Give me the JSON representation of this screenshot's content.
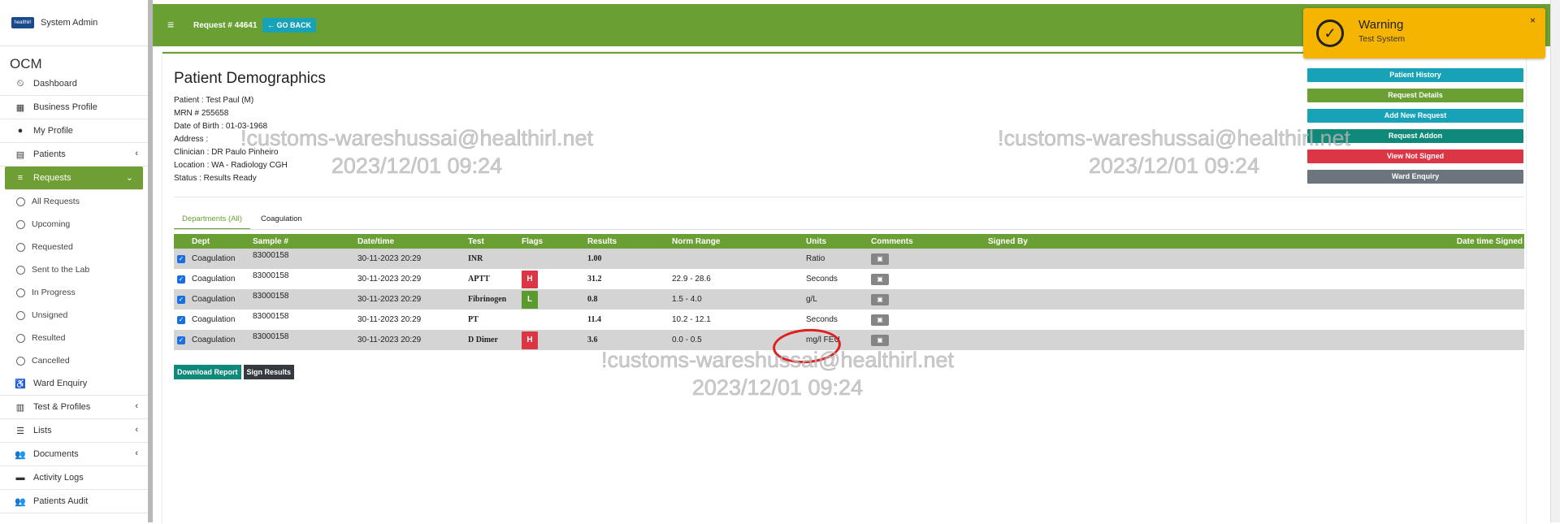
{
  "sidebar": {
    "user": "System Admin",
    "logo_text": "healthirl",
    "app_name": "OCM",
    "items": [
      {
        "label": "Dashboard",
        "icon": "⏲"
      },
      {
        "label": "Business Profile",
        "icon": "▦"
      },
      {
        "label": "My Profile",
        "icon": "●"
      },
      {
        "label": "Patients",
        "icon": "▤",
        "chevron": "‹"
      },
      {
        "label": "Requests",
        "icon": "≡",
        "chevron": "⌄"
      }
    ],
    "sub_items": [
      "All Requests",
      "Upcoming",
      "Requested",
      "Sent to the Lab",
      "In Progress",
      "Unsigned",
      "Resulted",
      "Cancelled"
    ],
    "items2": [
      {
        "label": "Ward Enquiry",
        "icon": "♿"
      },
      {
        "label": "Test & Profiles",
        "icon": "▥",
        "chevron": "‹"
      },
      {
        "label": "Lists",
        "icon": "☰",
        "chevron": "‹"
      },
      {
        "label": "Documents",
        "icon": "👥",
        "chevron": "‹"
      },
      {
        "label": "Activity Logs",
        "icon": "▬"
      },
      {
        "label": "Patients Audit",
        "icon": "👥"
      }
    ]
  },
  "topbar": {
    "menu_icon": "≡",
    "request_title": "Request # 44641",
    "go_back": "← GO BACK"
  },
  "patient": {
    "title": "Patient Demographics",
    "lines": [
      "Patient : Test Paul (M)",
      "MRN # 255658",
      "Date of Birth : 01-03-1968",
      "Address :",
      "Clinician : DR Paulo Pinheiro",
      "Location : WA - Radiology CGH",
      "Status : Results Ready"
    ]
  },
  "actions": [
    {
      "label": "Patient History",
      "color": "#17a2b8"
    },
    {
      "label": "Request Details",
      "color": "#6a9f34"
    },
    {
      "label": "Add New Request",
      "color": "#17a2b8"
    },
    {
      "label": "Request Addon",
      "color": "#0f8a7a"
    },
    {
      "label": "View Not Signed",
      "color": "#dc3545"
    },
    {
      "label": "Ward Enquiry",
      "color": "#6c757d"
    }
  ],
  "tabs": [
    "Departments (All)",
    "Coagulation"
  ],
  "table": {
    "headers": [
      "Dept",
      "Sample #",
      "Date/time",
      "Test",
      "Flags",
      "Results",
      "Norm Range",
      "Units",
      "Comments",
      "Signed By",
      "Date time Signed"
    ],
    "rows": [
      {
        "dept": "Coagulation",
        "sample": "83000158",
        "datetime": "30-11-2023 20:29",
        "test": "INR",
        "flag": "",
        "result": "1.00",
        "range": "",
        "units": "Ratio"
      },
      {
        "dept": "Coagulation",
        "sample": "83000158",
        "datetime": "30-11-2023 20:29",
        "test": "APTT",
        "flag": "H",
        "result": "31.2",
        "range": "22.9 - 28.6",
        "units": "Seconds"
      },
      {
        "dept": "Coagulation",
        "sample": "83000158",
        "datetime": "30-11-2023 20:29",
        "test": "Fibrinogen",
        "flag": "L",
        "result": "0.8",
        "range": "1.5 - 4.0",
        "units": "g/L"
      },
      {
        "dept": "Coagulation",
        "sample": "83000158",
        "datetime": "30-11-2023 20:29",
        "test": "PT",
        "flag": "",
        "result": "11.4",
        "range": "10.2 - 12.1",
        "units": "Seconds"
      },
      {
        "dept": "Coagulation",
        "sample": "83000158",
        "datetime": "30-11-2023 20:29",
        "test": "D Dimer",
        "flag": "H",
        "result": "3.6",
        "range": "0.0 - 0.5",
        "units": "mg/l FEU"
      }
    ]
  },
  "bottom_buttons": [
    {
      "label": "Download Report",
      "color": "#0f8a7a"
    },
    {
      "label": "Sign Results",
      "color": "#343a40"
    }
  ],
  "watermark": {
    "line1": "!customs-wareshussai@healthirl.net",
    "line2": "2023/12/01 09:24"
  },
  "toast": {
    "title": "Warning",
    "message": "Test System",
    "close": "×",
    "icon": "✓"
  }
}
